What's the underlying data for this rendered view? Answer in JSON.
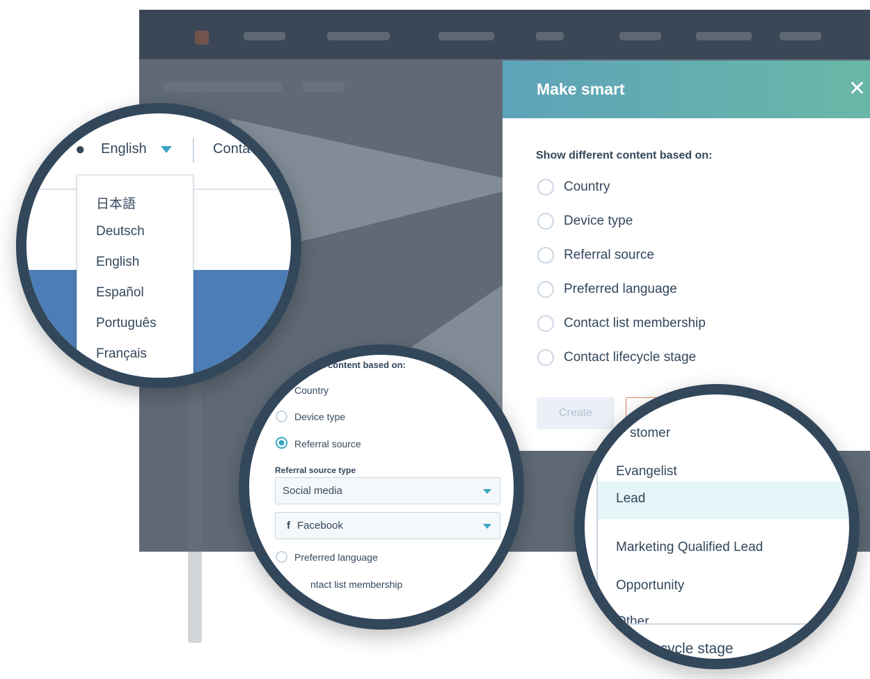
{
  "modal": {
    "title": "Make smart",
    "close_icon": "close-icon",
    "label": "Show different content based on:",
    "options": [
      "Country",
      "Device type",
      "Referral source",
      "Preferred language",
      "Contact list membership",
      "Contact lifecycle stage"
    ],
    "create_label": "Create"
  },
  "language_zoom": {
    "current": "English",
    "next_tab": "Conta",
    "languages": [
      "日本語",
      "Deutsch",
      "English",
      "Español",
      "Português",
      "Français"
    ]
  },
  "referral_zoom": {
    "label_partial": "t content based on:",
    "options": [
      "Country",
      "Device type",
      "Referral source"
    ],
    "selected": "Referral source",
    "type_label": "Referral source type",
    "type_value": "Social media",
    "network_value": "Facebook",
    "after": [
      "Preferred language",
      "ntact list membership"
    ]
  },
  "lifecycle_zoom": {
    "items": [
      "stomer",
      "Evangelist",
      "Lead",
      "Marketing Qualified Lead",
      "Opportunity",
      "Other"
    ],
    "highlighted": "Lead",
    "footer": "t lifecycle stage"
  },
  "colors": {
    "accent": "#3aa5c2",
    "header_start": "#5ea3b9",
    "header_end": "#6ab7a7",
    "ring": "#33475b"
  }
}
